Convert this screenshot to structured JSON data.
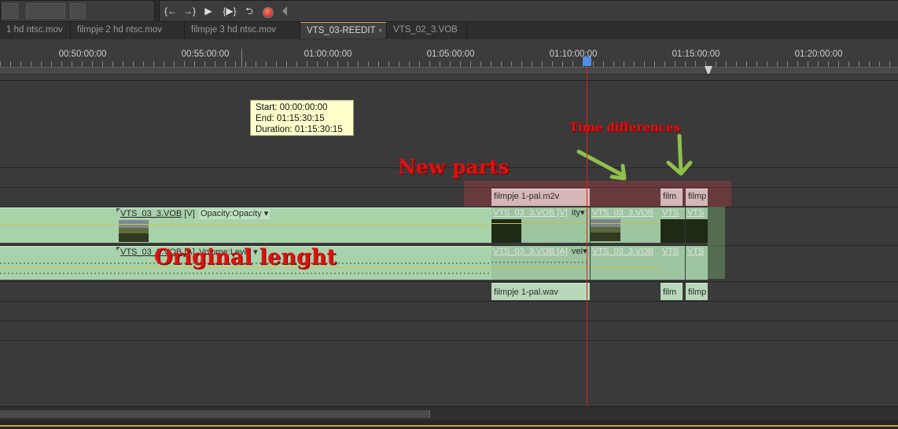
{
  "transport": {
    "buttons": [
      {
        "name": "go-to-in-icon",
        "glyph": "{←"
      },
      {
        "name": "go-to-out-icon",
        "glyph": "→}"
      },
      {
        "name": "play-icon",
        "glyph": "▶"
      },
      {
        "name": "play-in-to-out-icon",
        "glyph": "{▶}"
      },
      {
        "name": "loop-icon",
        "glyph": "⮌"
      }
    ]
  },
  "tabs": [
    {
      "label": "1 hd ntsc.mov",
      "active": false
    },
    {
      "label": "filmpje 2  hd ntsc.mov",
      "active": false
    },
    {
      "label": "filmpje 3  hd ntsc.mov",
      "active": false
    },
    {
      "label": "VTS_03-REEDIT",
      "active": true,
      "close": "×"
    },
    {
      "label": "VTS_02_3.VOB",
      "active": false
    }
  ],
  "ruler": {
    "timecodes": [
      "00:50:00:00",
      "00:55:00:00",
      "01:00:00:00",
      "01:05:00:00",
      "01:10:00:00",
      "01:15:00:00",
      "01:20:00:00"
    ]
  },
  "tooltip": {
    "start": "Start: 00:00:00:00",
    "end": "End: 01:15:30:15",
    "duration": "Duration: 01:15:30:15"
  },
  "annotations": {
    "time_differences": "Time differences",
    "new_parts": "New parts",
    "original_length": "Original lenght"
  },
  "clips": {
    "pink_main": "filmpje 1-pal.m2v",
    "pink_small1": "film",
    "pink_small2": "filmp",
    "video_name": "VTS_03_3.VOB",
    "video_tag": "[V]",
    "video_effect": "Opacity:Opacity",
    "audio_name": "VTS_03_3.VOB",
    "audio_tag": "[A]",
    "audio_effect": "Volume:Level",
    "faded_video": "VTS_03_3.VOB [V]",
    "faded_video_effect": "ity",
    "faded_video2": "VTS_03_3.VOB",
    "faded_small_a": "VTS",
    "faded_small_b": "VTS",
    "faded_audio": "VTS_03_3.VOB [A]",
    "faded_audio_effect": "vel",
    "faded_audio2": "VTS_03_3.VOB",
    "wav_main": "filmpje 1-pal.wav",
    "wav_small1": "film",
    "wav_small2": "filmp"
  }
}
